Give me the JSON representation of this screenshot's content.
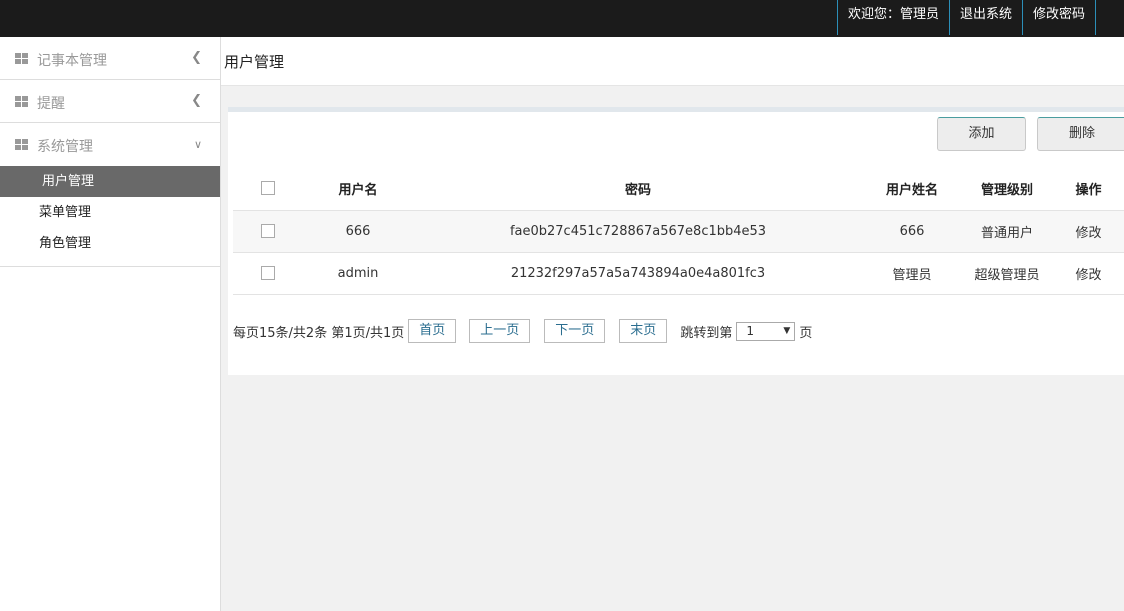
{
  "header": {
    "welcome": "欢迎您：管理员",
    "logout": "退出系统",
    "change_password": "修改密码"
  },
  "sidebar": {
    "groups": [
      {
        "label": "记事本管理",
        "expanded": false
      },
      {
        "label": "提醒",
        "expanded": false
      },
      {
        "label": "系统管理",
        "expanded": true
      }
    ],
    "sub_items": [
      "用户管理",
      "菜单管理",
      "角色管理"
    ],
    "active": "用户管理"
  },
  "page": {
    "title": "用户管理"
  },
  "toolbar": {
    "add": "添加",
    "delete": "删除"
  },
  "table": {
    "headers": [
      "用户名",
      "密码",
      "用户姓名",
      "管理级别",
      "操作"
    ],
    "rows": [
      {
        "username": "666",
        "password": "fae0b27c451c728867a567e8c1bb4e53",
        "name": "666",
        "level": "普通用户",
        "action": "修改"
      },
      {
        "username": "admin",
        "password": "21232f297a57a5a743894a0e4a801fc3",
        "name": "管理员",
        "level": "超级管理员",
        "action": "修改"
      }
    ]
  },
  "pager": {
    "summary": "每页15条/共2条 第1页/共1页",
    "first": "首页",
    "prev": "上一页",
    "next": "下一页",
    "last": "末页",
    "jump_label": "跳转到第",
    "jump_value": "1",
    "page_suffix": "页"
  },
  "colors": {
    "topbar": "#1b1b1b",
    "active_item": "#696969",
    "accent_border": "#2c8fb8",
    "link": "#2a6d8f"
  }
}
